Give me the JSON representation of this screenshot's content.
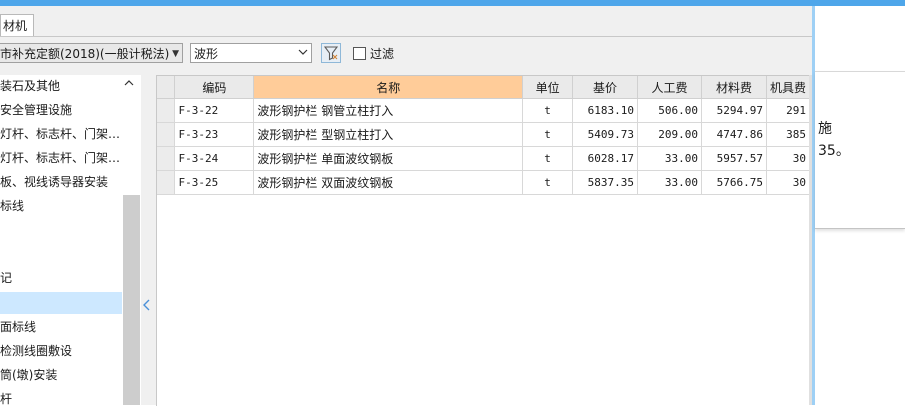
{
  "tab": {
    "label": "材机"
  },
  "toolbar": {
    "quota_select": "市补充定额(2018)(一般计税法)",
    "search_select": "波形",
    "filter_checkbox_label": "过滤"
  },
  "tree": {
    "items": [
      "装石及其他",
      "安全管理设施",
      "灯杆、标志杆、门架…",
      "灯杆、标志杆、门架…",
      "板、视线诱导器安装",
      "标线",
      "",
      "",
      "记",
      "",
      "面标线",
      "检测线圈敷设",
      "筒(墩)安装",
      "杆"
    ],
    "selected_index": 9
  },
  "grid": {
    "columns": [
      "编码",
      "名称",
      "单位",
      "基价",
      "人工费",
      "材料费",
      "机具费"
    ],
    "rows": [
      [
        "F-3-22",
        "波形钢护栏 钢管立柱打入",
        "t",
        "6183.10",
        "506.00",
        "5294.97",
        "291"
      ],
      [
        "F-3-23",
        "波形钢护栏 型钢立柱打入",
        "t",
        "5409.73",
        "209.00",
        "4747.86",
        "385"
      ],
      [
        "F-3-24",
        "波形钢护栏 单面波纹钢板",
        "t",
        "6028.17",
        "33.00",
        "5957.57",
        "30"
      ],
      [
        "F-3-25",
        "波形钢护栏 双面波纹钢板",
        "t",
        "5837.35",
        "33.00",
        "5766.75",
        "30"
      ]
    ]
  },
  "popup": {
    "line1": "施",
    "line2": "35。"
  },
  "colors": {
    "top_accent": "#4ea6ea",
    "name_header": "#ffcc99",
    "selection": "#cde8ff"
  }
}
